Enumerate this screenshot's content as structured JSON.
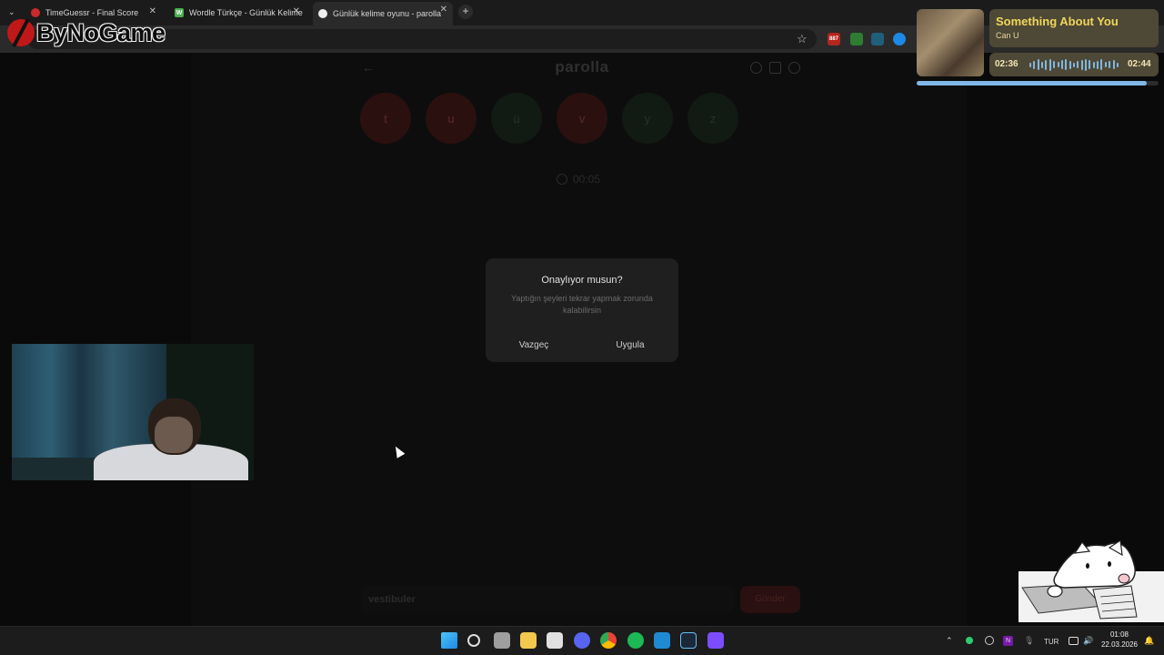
{
  "browser": {
    "tabs": [
      {
        "title": "TimeGuessr - Final Score",
        "favicon": "timeguessr-icon",
        "active": false
      },
      {
        "title": "Wordle Türkçe - Günlük Kelime",
        "favicon": "wordle-icon",
        "active": false
      },
      {
        "title": "Günlük kelime oyunu - parolla",
        "favicon": "parolla-icon",
        "active": true
      }
    ],
    "extension_badge": "887"
  },
  "watermark": {
    "text": "ByNoGame"
  },
  "app": {
    "title": "parolla",
    "letters": [
      {
        "char": "t",
        "state": "red"
      },
      {
        "char": "u",
        "state": "red"
      },
      {
        "char": "ü",
        "state": "green"
      },
      {
        "char": "v",
        "state": "red"
      },
      {
        "char": "y",
        "state": "green"
      },
      {
        "char": "z",
        "state": "green"
      }
    ],
    "timer": "00:05",
    "input_value": "vestibuler",
    "send_label": "Gönder"
  },
  "modal": {
    "title": "Onaylıyor musun?",
    "body": "Yaptığın şeyleri tekrar yapmak zorunda kalabilirsin",
    "cancel": "Vazgeç",
    "apply": "Uygula"
  },
  "music": {
    "title": "Something About You",
    "artist": "Can U",
    "elapsed": "02:36",
    "duration": "02:44",
    "progress": 0.95
  },
  "taskbar": {
    "language": "TUR",
    "time": "01:08",
    "date": "22.03.2026"
  },
  "colors": {
    "red_circle": "#2b1010",
    "green_circle": "#121a14",
    "modal_bg": "#1f1f1f",
    "music_accent": "#f0d75a"
  }
}
